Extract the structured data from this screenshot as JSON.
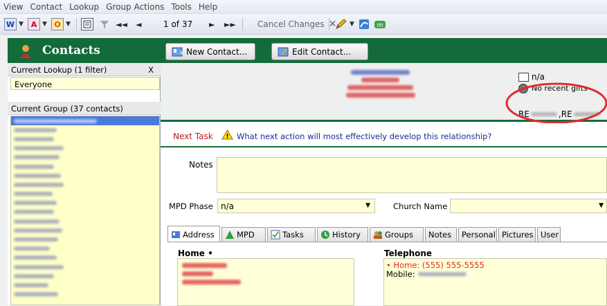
{
  "menu": [
    "View",
    "Contact",
    "Lookup",
    "Group Actions",
    "Tools",
    "Help"
  ],
  "toolbar": {
    "word_letter": "W",
    "access_letter": "A",
    "outlook_letter": "O",
    "record_position": "1 of 37",
    "cancel_changes": "Cancel Changes"
  },
  "contacts_title": "Contacts",
  "buttons": {
    "new_contact": "New Contact...",
    "edit_contact": "Edit Contact..."
  },
  "left": {
    "current_lookup": "Current Lookup (1 filter)",
    "close_x": "X",
    "lookup_value": "Everyone",
    "current_group": "Current Group (37 contacts)"
  },
  "summary": {
    "na_label": "n/a",
    "no_recent_gifts": "No recent gifts",
    "re_prefix1": "RE",
    "re_prefix2": ",RE"
  },
  "next_task": {
    "label": "Next Task",
    "text": "What next action will most effectively develop this relationship?"
  },
  "notes_label": "Notes",
  "mpd_phase": {
    "label": "MPD Phase",
    "value": "n/a"
  },
  "church_name_label": "Church Name",
  "tabs": [
    "Address",
    "MPD",
    "Tasks",
    "History",
    "Groups",
    "Notes",
    "Personal",
    "Pictures",
    "User"
  ],
  "address": {
    "home_label": "Home •",
    "telephone_label": "Telephone",
    "home_phone": "• Home: (555) 555-5555",
    "mobile_label": "Mobile:"
  },
  "colors": {
    "brand_green": "#146b3a",
    "highlight_red": "#e32b2b",
    "field_yellow": "#ffffd8"
  }
}
